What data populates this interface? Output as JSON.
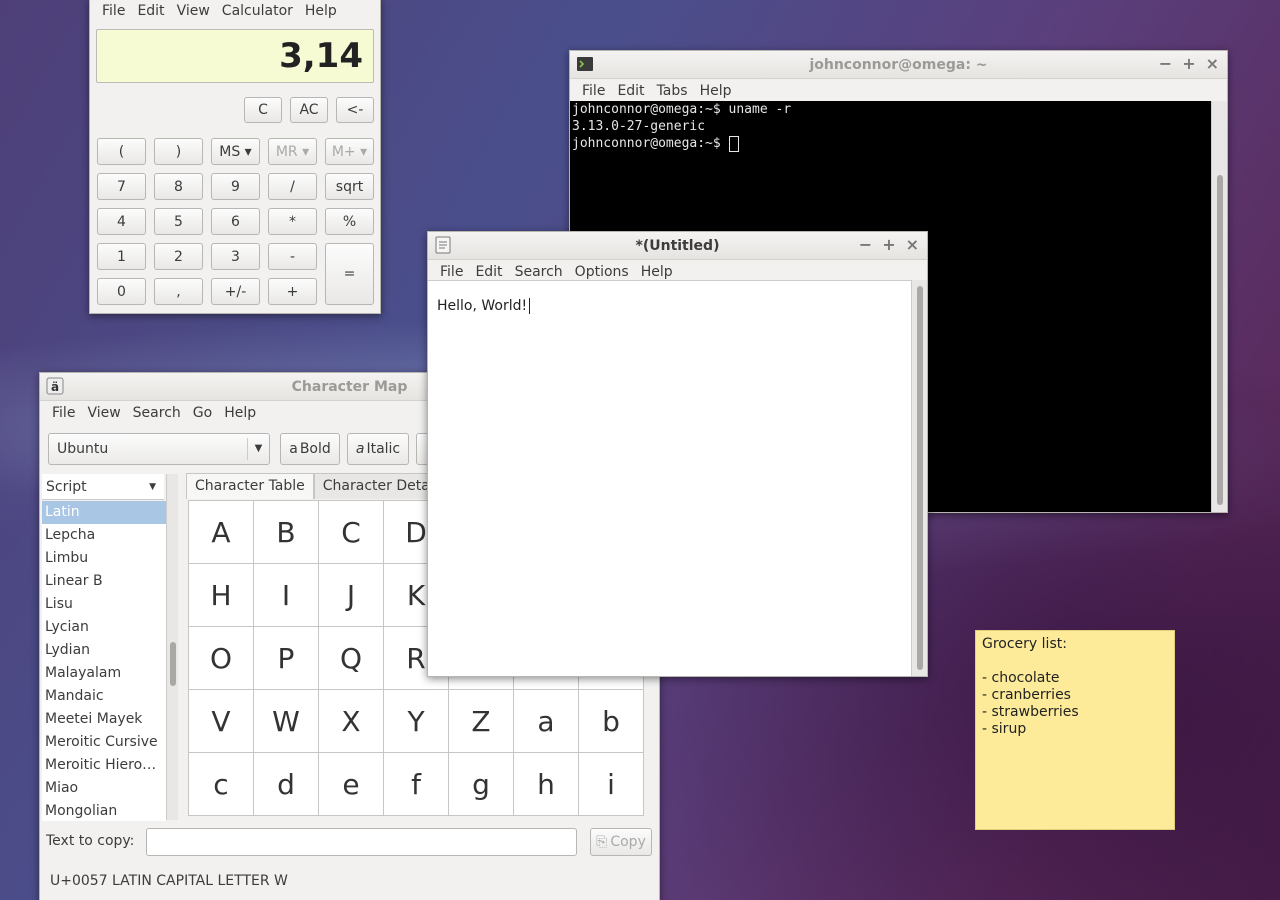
{
  "calculator": {
    "menu": [
      "File",
      "Edit",
      "View",
      "Calculator",
      "Help"
    ],
    "display": "3,14",
    "top_buttons": [
      "C",
      "AC",
      "<-"
    ],
    "keys": [
      [
        "(",
        ")",
        "MS ▾",
        "MR ▾",
        "M+ ▾"
      ],
      [
        "7",
        "8",
        "9",
        "/",
        "sqrt"
      ],
      [
        "4",
        "5",
        "6",
        "*",
        "%"
      ],
      [
        "1",
        "2",
        "3",
        "-",
        "="
      ],
      [
        "0",
        ",",
        "+/-",
        "+"
      ]
    ]
  },
  "terminal": {
    "title": "johnconnor@omega: ~",
    "menu": [
      "File",
      "Edit",
      "Tabs",
      "Help"
    ],
    "lines": [
      "johnconnor@omega:~$ uname -r",
      "3.13.0-27-generic",
      "johnconnor@omega:~$ "
    ]
  },
  "editor": {
    "title": "*(Untitled)",
    "menu": [
      "File",
      "Edit",
      "Search",
      "Options",
      "Help"
    ],
    "content": "Hello, World!"
  },
  "charmap": {
    "title": "Character Map",
    "menu": [
      "File",
      "View",
      "Search",
      "Go",
      "Help"
    ],
    "font": "Ubuntu",
    "bold_label": "Bold",
    "italic_label": "Italic",
    "script_combo": "Script",
    "scripts": [
      "Latin",
      "Lepcha",
      "Limbu",
      "Linear B",
      "Lisu",
      "Lycian",
      "Lydian",
      "Malayalam",
      "Mandaic",
      "Meetei Mayek",
      "Meroitic Cursive",
      "Meroitic Hiero…",
      "Miao",
      "Mongolian"
    ],
    "selected_script": "Latin",
    "tabs": [
      "Character Table",
      "Character Detail"
    ],
    "chars": [
      "A",
      "B",
      "C",
      "D",
      "",
      "",
      "",
      "H",
      "I",
      "J",
      "K",
      "",
      "",
      "",
      "O",
      "P",
      "Q",
      "R",
      "",
      "",
      "",
      "V",
      "W",
      "X",
      "Y",
      "Z",
      "a",
      "b",
      "c",
      "d",
      "e",
      "f",
      "g",
      "h",
      "i"
    ],
    "text_to_copy_label": "Text to copy:",
    "copy_label": "Copy",
    "status": "U+0057 LATIN CAPITAL LETTER W"
  },
  "sticky": {
    "title": "Grocery list:",
    "items": [
      "- chocolate",
      "- cranberries",
      "- strawberries",
      "- sirup"
    ]
  }
}
